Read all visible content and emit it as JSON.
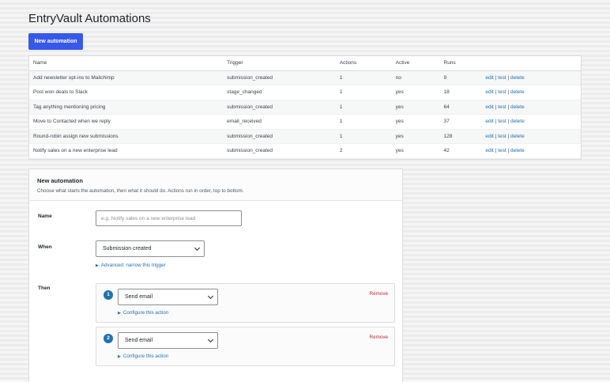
{
  "page": {
    "title": "EntryVault Automations",
    "new_button": "New automation"
  },
  "table": {
    "headers": [
      "Name",
      "Trigger",
      "Actions",
      "Active",
      "Runs",
      ""
    ],
    "rows": [
      {
        "name": "Add newsletter opt-ins to Mailchimp",
        "trigger": "submission_created",
        "actions": "1",
        "active": "no",
        "runs": "9"
      },
      {
        "name": "Post won deals to Slack",
        "trigger": "stage_changed",
        "actions": "1",
        "active": "yes",
        "runs": "18"
      },
      {
        "name": "Tag anything mentioning pricing",
        "trigger": "submission_created",
        "actions": "1",
        "active": "yes",
        "runs": "64"
      },
      {
        "name": "Move to Contacted when we reply",
        "trigger": "email_received",
        "actions": "1",
        "active": "yes",
        "runs": "37"
      },
      {
        "name": "Round-robin assign new submissions",
        "trigger": "submission_created",
        "actions": "1",
        "active": "yes",
        "runs": "128"
      },
      {
        "name": "Notify sales on a new enterprise lead",
        "trigger": "submission_created",
        "actions": "2",
        "active": "yes",
        "runs": "42"
      }
    ],
    "row_links": {
      "edit": "edit",
      "test": "test",
      "delete": "delete",
      "separator": "|"
    }
  },
  "form": {
    "title": "New automation",
    "description": "Choose what starts the automation, then what it should do. Actions run in order, top to bottom.",
    "name_label": "Name",
    "name_placeholder": "e.g. Notify sales on a new enterprise lead",
    "when_label": "When",
    "when_value": "Submission created",
    "advanced_link": "Advanced: narrow this trigger",
    "then_label": "Then",
    "actions": [
      {
        "step": "1",
        "value": "Send email",
        "configure": "Configure this action",
        "remove": "Remove"
      },
      {
        "step": "2",
        "value": "Send email",
        "configure": "Configure this action",
        "remove": "Remove"
      }
    ]
  },
  "colors": {
    "primary_button": "#3858e9",
    "link": "#2271b1",
    "danger": "#b32d2e"
  }
}
